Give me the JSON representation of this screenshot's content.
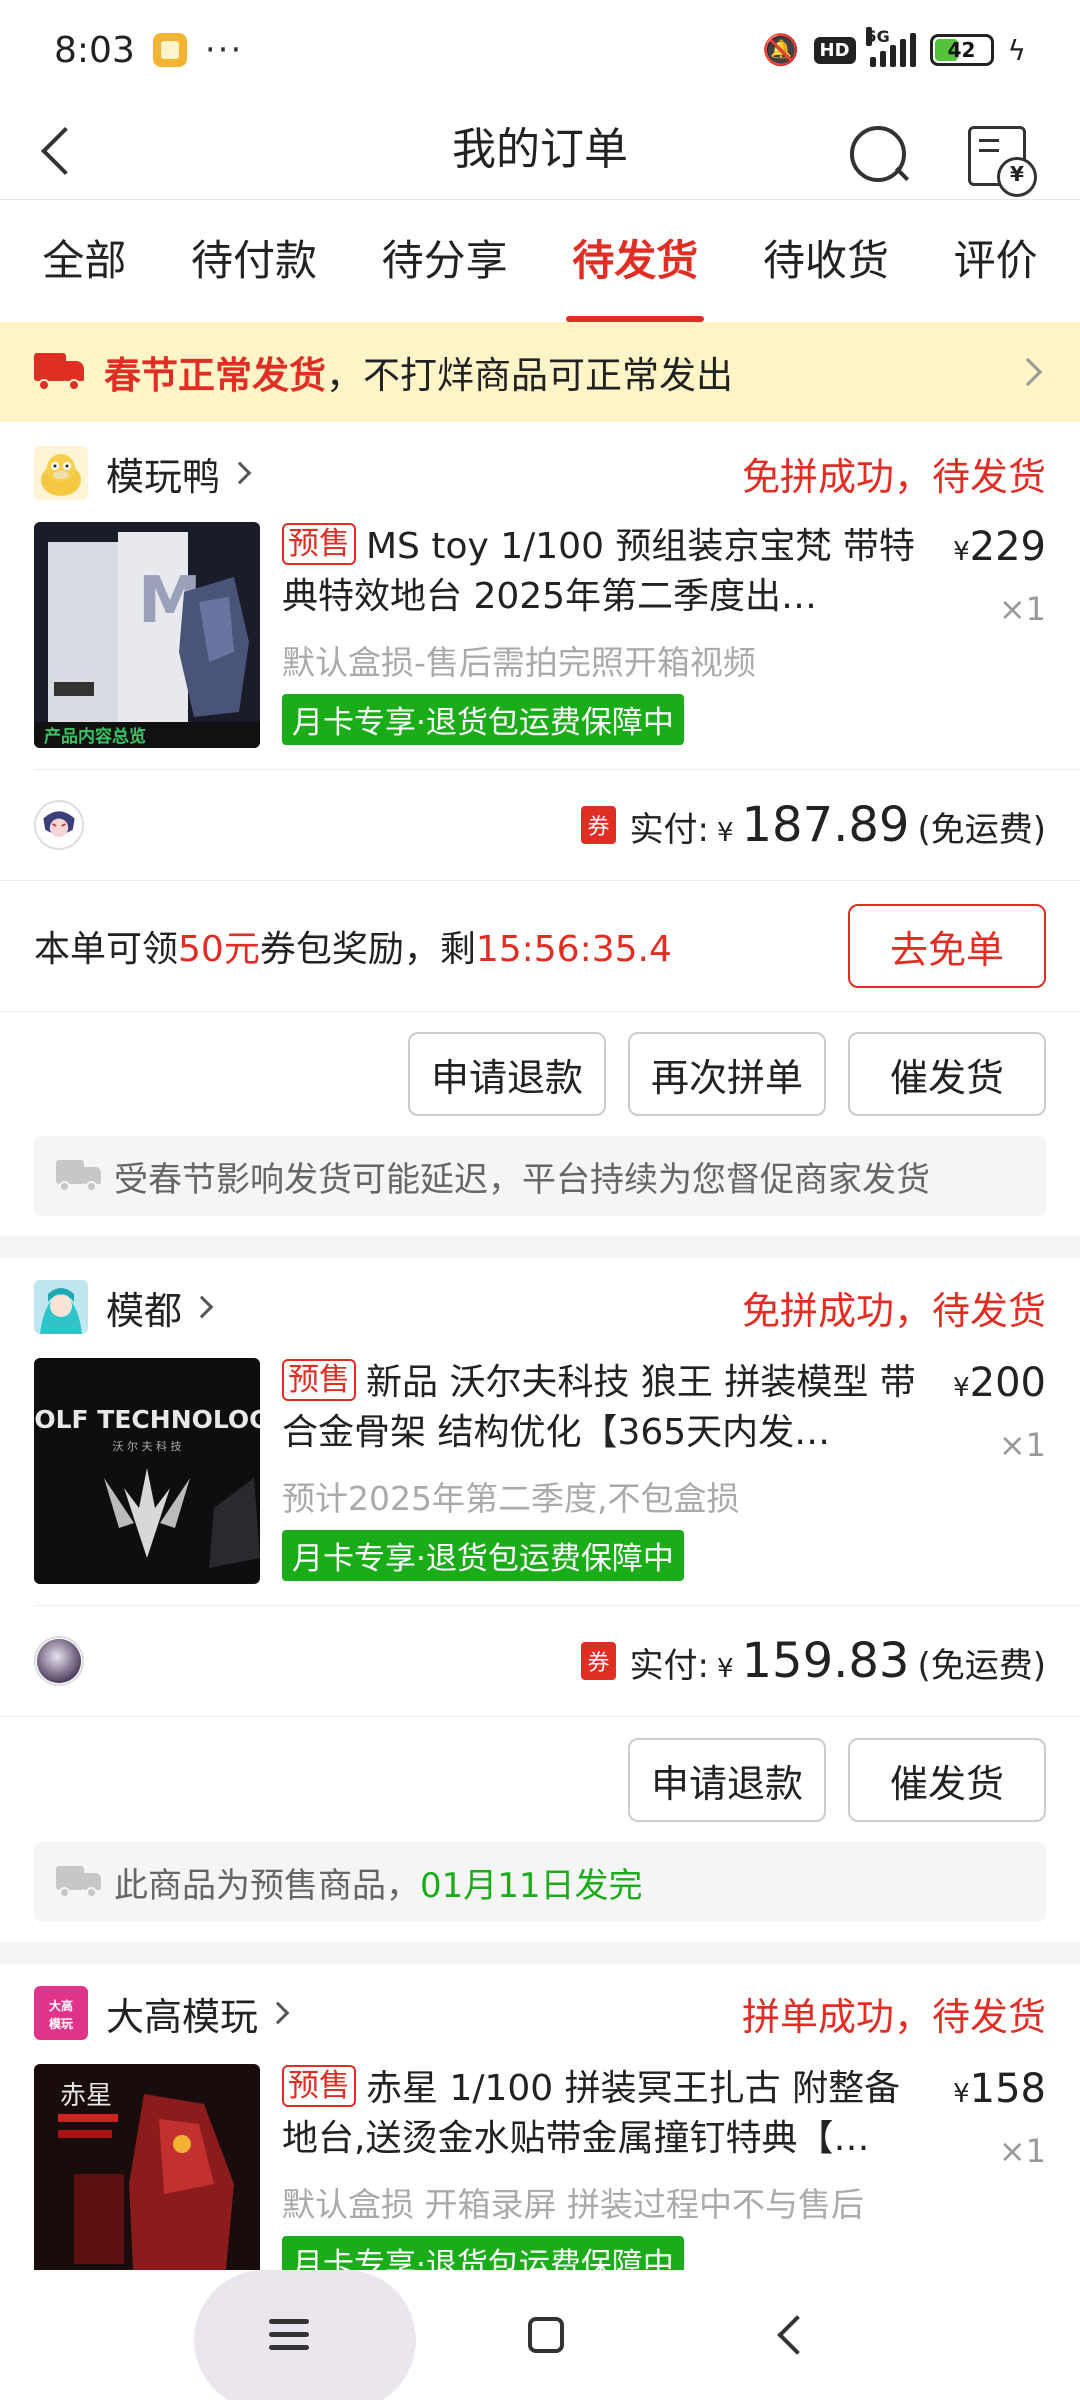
{
  "status_bar": {
    "time": "8:03",
    "dots": "···",
    "network": "5G",
    "hd": "HD",
    "battery": "42",
    "icons": [
      "app-notification-icon",
      "mute-icon",
      "signal-icon",
      "battery-icon",
      "charging-icon"
    ]
  },
  "nav": {
    "title": "我的订单",
    "icons": [
      "back-icon",
      "search-icon",
      "bill-icon"
    ]
  },
  "tabs": [
    {
      "label": "全部",
      "active": false
    },
    {
      "label": "待付款",
      "active": false
    },
    {
      "label": "待分享",
      "active": false
    },
    {
      "label": "待发货",
      "active": true
    },
    {
      "label": "待收货",
      "active": false
    },
    {
      "label": "评价",
      "active": false
    }
  ],
  "notice": {
    "highlight": "春节正常发货",
    "text": "，不打烊商品可正常发出"
  },
  "orders": [
    {
      "shop": "模玩鸭",
      "status": "免拼成功，待发货",
      "presale": "预售",
      "title": "MS toy 1/100 预组装京宝梵 带特典特效地台 2025年第二季度出…",
      "spec": "默认盒损-售后需拍完照开箱视频",
      "tag": "月卡专享·退货包运费保障中",
      "price_symbol": "¥",
      "price": "229",
      "qty": "×1",
      "coupon": "券",
      "pay_label": "实付:",
      "pay_symbol": "¥",
      "pay_amount": "187.89",
      "shipping": "(免运费)",
      "reward_prefix": "本单可领",
      "reward_amount": "50元",
      "reward_mid": "券包奖励，剩",
      "reward_timer": "15:56:35.4",
      "reward_button": "去免单",
      "buttons": [
        "申请退款",
        "再次拼单",
        "催发货"
      ],
      "info": "受春节影响发货可能延迟，平台持续为您督促商家发货",
      "info_highlight": ""
    },
    {
      "shop": "模都",
      "status": "免拼成功，待发货",
      "presale": "预售",
      "title": "新品 沃尔夫科技 狼王 拼装模型 带合金骨架 结构优化【365天内发…",
      "spec": "预计2025年第二季度,不包盒损",
      "tag": "月卡专享·退货包运费保障中",
      "price_symbol": "¥",
      "price": "200",
      "qty": "×1",
      "coupon": "券",
      "pay_label": "实付:",
      "pay_symbol": "¥",
      "pay_amount": "159.83",
      "shipping": "(免运费)",
      "buttons": [
        "申请退款",
        "催发货"
      ],
      "info": "此商品为预售商品，",
      "info_highlight": "01月11日发完",
      "thumb_text": "WOLF TECHNOLOGY",
      "thumb_sub": "沃 尔 夫 科 技"
    },
    {
      "shop": "大高模玩",
      "shop_logo_text": "大高模玩",
      "status": "拼单成功，待发货",
      "presale": "预售",
      "title": "赤星 1/100 拼装冥王扎古 附整备地台,送烫金水贴带金属撞钉特典【…",
      "spec": "默认盒损 开箱录屏 拼装过程中不与售后",
      "tag": "月卡专享·退货包运费保障中",
      "price_symbol": "¥",
      "price": "158",
      "qty": "×1",
      "thumb_text": "赤星"
    }
  ],
  "thumb1_label": "产品内容总览",
  "colors": {
    "accent": "#e02e24",
    "green": "#1aad19",
    "notice_bg": "#fdf4c7"
  }
}
